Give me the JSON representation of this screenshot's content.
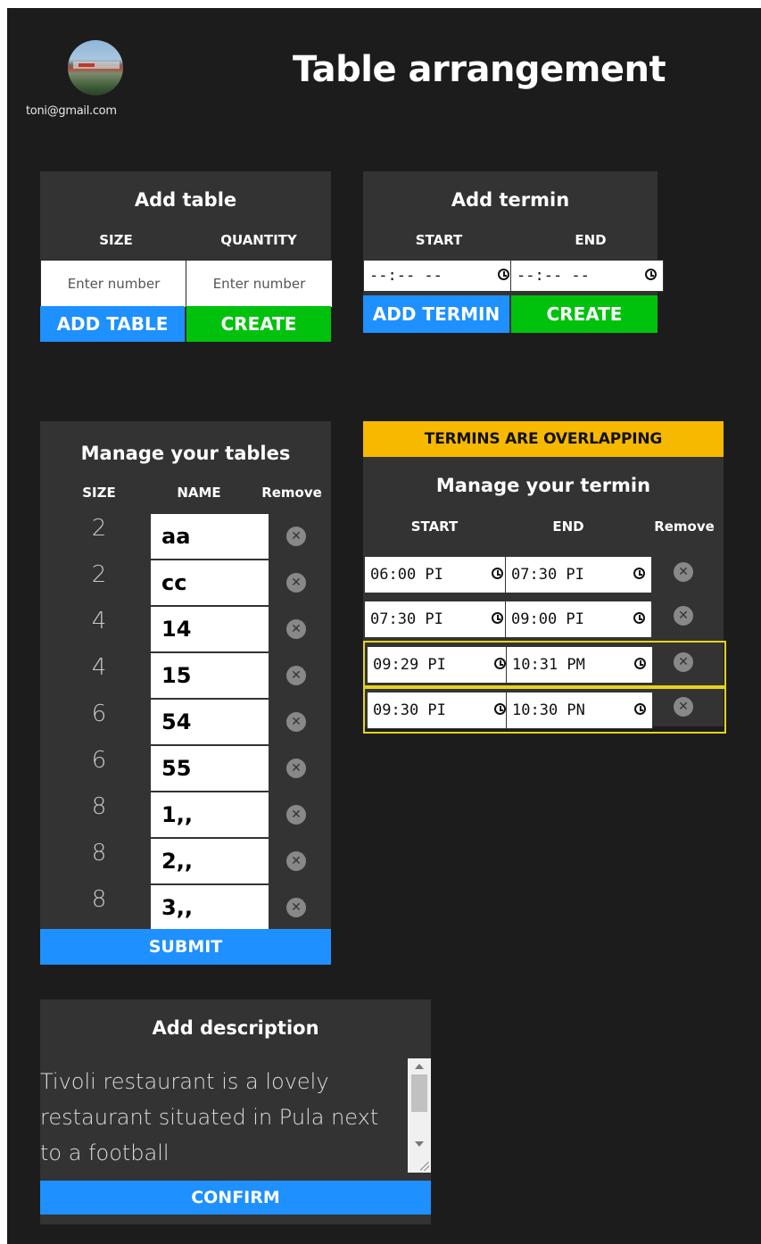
{
  "header": {
    "email": "toni@gmail.com",
    "title": "Table arrangement"
  },
  "add_table": {
    "title": "Add table",
    "col_size": "SIZE",
    "col_quantity": "QUANTITY",
    "size_placeholder": "Enter number",
    "quantity_placeholder": "Enter number",
    "add_label": "ADD TABLE",
    "create_label": "CREATE"
  },
  "add_termin": {
    "title": "Add termin",
    "col_start": "START",
    "col_end": "END",
    "start_value": "--:-- --",
    "end_value": "--:-- --",
    "add_label": "ADD TERMIN",
    "create_label": "CREATE"
  },
  "manage_tables": {
    "title": "Manage your tables",
    "col_size": "SIZE",
    "col_name": "NAME",
    "col_remove": "Remove",
    "rows": [
      {
        "size": "2",
        "name": "aa"
      },
      {
        "size": "2",
        "name": "cc"
      },
      {
        "size": "4",
        "name": "14"
      },
      {
        "size": "4",
        "name": "15"
      },
      {
        "size": "6",
        "name": "54"
      },
      {
        "size": "6",
        "name": "55"
      },
      {
        "size": "8",
        "name": "1,,"
      },
      {
        "size": "8",
        "name": "2,,"
      },
      {
        "size": "8",
        "name": "3,,"
      }
    ],
    "submit_label": "SUBMIT"
  },
  "manage_termin": {
    "warning": "TERMINS ARE OVERLAPPING",
    "title": "Manage your termin",
    "col_start": "START",
    "col_end": "END",
    "col_remove": "Remove",
    "rows": [
      {
        "start": "06:00 PI",
        "end": "07:30 PI",
        "overlapping": false
      },
      {
        "start": "07:30 PI",
        "end": "09:00 PI",
        "overlapping": false
      },
      {
        "start": "09:29 PI",
        "end": "10:31 PM",
        "overlapping": true
      },
      {
        "start": "09:30 PI",
        "end": "10:30 PN",
        "overlapping": true
      }
    ]
  },
  "description": {
    "title": "Add description",
    "text": "Tivoli restaurant is a lovely restaurant situated in Pula next to a football",
    "confirm_label": "CONFIRM"
  },
  "colors": {
    "background": "#1c1c1c",
    "panel": "#333333",
    "blue": "#1e90ff",
    "green": "#00c20d",
    "warning": "#f7b800",
    "overlap_border": "#e6d31c"
  }
}
